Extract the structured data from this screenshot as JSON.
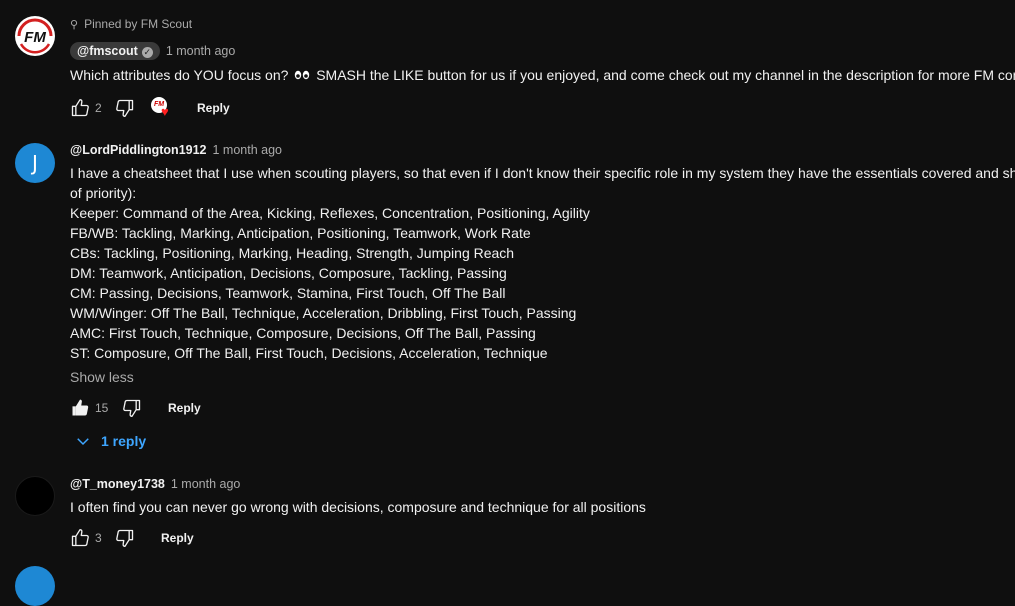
{
  "comments": [
    {
      "pinned": "Pinned by FM Scout",
      "handle": "@fmscout",
      "time": "1 month ago",
      "text_before": "Which attributes do YOU focus on?",
      "text_after": "SMASH the LIKE button for us if you enjoyed, and come check out my channel in the description for more FM content!",
      "likes": "2",
      "reply_label": "Reply"
    },
    {
      "avatar_letter": "J",
      "handle": "@LordPiddlington1912",
      "time": "1 month ago",
      "lines": [
        "I have a cheatsheet that I use when scouting players, so that even if I don't know their specific role in my system they have the essentials covered and should",
        "of priority):",
        "Keeper: Command of the Area, Kicking, Reflexes, Concentration, Positioning, Agility",
        "FB/WB: Tackling, Marking, Anticipation, Positioning, Teamwork, Work Rate",
        "CBs: Tackling, Positioning, Marking, Heading, Strength, Jumping Reach",
        "DM: Teamwork, Anticipation, Decisions, Composure, Tackling, Passing",
        "CM: Passing, Decisions, Teamwork, Stamina, First Touch, Off The Ball",
        "WM/Winger: Off The Ball, Technique, Acceleration, Dribbling, First Touch, Passing",
        "AMC: First Touch, Technique, Composure, Decisions, Off The Ball, Passing",
        "ST: Composure, Off The Ball, First Touch, Decisions, Acceleration, Technique"
      ],
      "show_less": "Show less",
      "likes": "15",
      "reply_label": "Reply",
      "replies_label": "1 reply"
    },
    {
      "handle": "@T_money1738",
      "time": "1 month ago",
      "text": "I often find you can never go wrong with decisions, composure and technique for all positions",
      "likes": "3",
      "reply_label": "Reply"
    }
  ],
  "colors": {
    "link": "#3ea6ff",
    "background": "#0f0f0f",
    "heart": "#ff2020",
    "avatar_j": "#1e88d4"
  },
  "icons": [
    "pin-icon",
    "verified-icon",
    "like-icon",
    "dislike-icon",
    "creator-heart-icon",
    "chevron-down-icon"
  ]
}
